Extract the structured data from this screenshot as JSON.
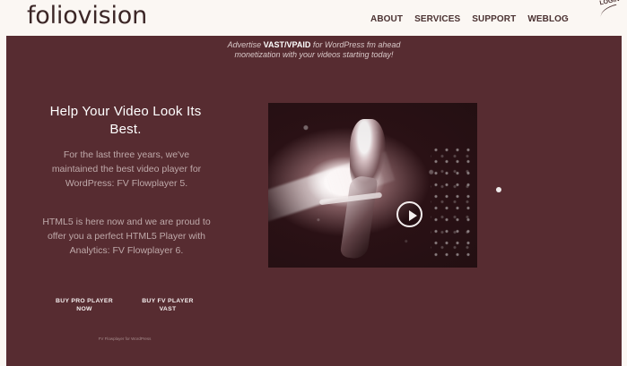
{
  "header": {
    "logo_text": "foliovision",
    "nav": [
      {
        "label": "ABOUT"
      },
      {
        "label": "SERVICES"
      },
      {
        "label": "SUPPORT"
      },
      {
        "label": "WEBLOG"
      }
    ],
    "login_label": "LOGIN"
  },
  "hero": {
    "announcement_prefix": "Advertise",
    "announcement_bold": "VAST/VPAID",
    "announcement_suffix": "for WordPress fm ahead",
    "announcement_line2": "monetization with your videos starting today!",
    "headline": "Help Your Video Look Its Best.",
    "paragraph_one": "For the last three years, we've maintained the best video player for WordPress: FV Flowplayer 5.",
    "paragraph_two": "HTML5 is here now and we are proud to offer you a perfect HTML5 Player with Analytics: FV Flowplayer 6.",
    "buttons": [
      {
        "label": "BUY PRO PLAYER NOW"
      },
      {
        "label": "BUY FV PLAYER VAST"
      }
    ],
    "caption": "FV Flowplayer for WordPress"
  },
  "colors": {
    "hero_background": "#572c31",
    "page_background": "#fbf7f3",
    "text_light": "#ffffff"
  },
  "icons": {
    "play": "play-icon",
    "search": "search-icon",
    "login": "login-icon"
  }
}
